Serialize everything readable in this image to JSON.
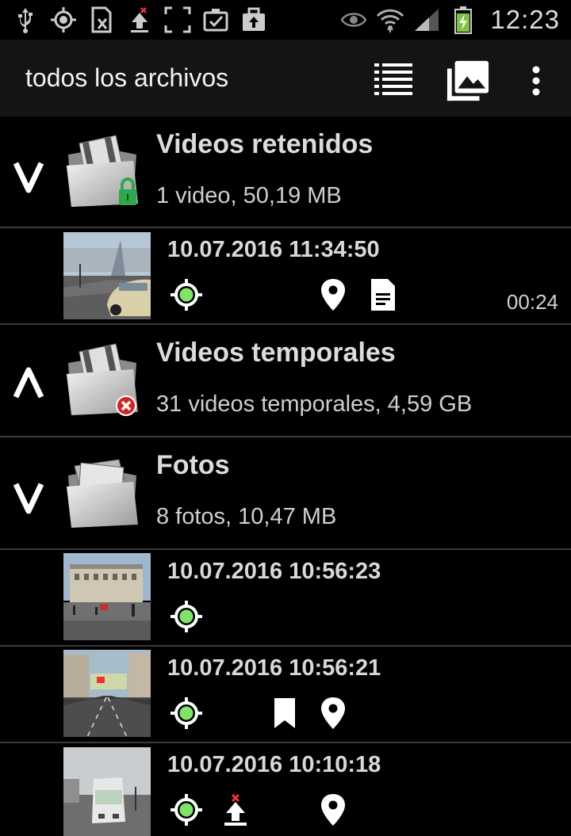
{
  "status_bar": {
    "time": "12:23",
    "icons": [
      "usb-icon",
      "gps-icon",
      "sim-icon",
      "upload-icon",
      "screenshot-icon",
      "clipboard-check-icon",
      "bag-upload-icon",
      "eye-icon",
      "wifi-icon",
      "signal-icon",
      "battery-charging-icon"
    ]
  },
  "app_bar": {
    "title": "todos los archivos",
    "actions": [
      "list-view-icon",
      "gallery-icon",
      "overflow-menu-icon"
    ]
  },
  "groups": [
    {
      "title": "Videos retenidos",
      "subtitle": "1 video, 50,19 MB",
      "expanded": true,
      "badge": "lock"
    },
    {
      "title": "Videos temporales",
      "subtitle": "31 videos temporales, 4,59 GB",
      "expanded": false,
      "badge": "error"
    },
    {
      "title": "Fotos",
      "subtitle": "8 fotos, 10,47 MB",
      "expanded": true,
      "badge": "none"
    }
  ],
  "items": [
    {
      "timestamp": "10.07.2016 11:34:50",
      "duration": "00:24",
      "icons": [
        "gps-fix-icon",
        "location-pin-icon",
        "document-icon"
      ]
    },
    {
      "timestamp": "10.07.2016 10:56:23",
      "icons": [
        "gps-fix-icon"
      ]
    },
    {
      "timestamp": "10.07.2016 10:56:21",
      "icons": [
        "gps-fix-icon",
        "bookmark-icon",
        "location-pin-icon"
      ]
    },
    {
      "timestamp": "10.07.2016 10:10:18",
      "icons": [
        "gps-fix-icon",
        "upload-failed-icon",
        "location-pin-icon"
      ]
    }
  ],
  "colors": {
    "background": "#000000",
    "app_bar": "#141414",
    "gps_fix": "#7fe36a",
    "lock_badge": "#2fa84a",
    "error_badge": "#d32424",
    "battery": "#7fc241"
  }
}
